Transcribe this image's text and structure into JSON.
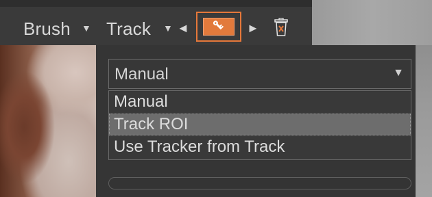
{
  "toolbar": {
    "brush_label": "Brush",
    "track_label": "Track",
    "dropdown_arrow": "▼",
    "prev_arrow": "◄",
    "next_arrow": "►",
    "key_button_icon": "key-icon",
    "delete_icon": "trash-icon",
    "accent_color": "#e6783a"
  },
  "tracking_mode": {
    "selected_value": "Manual",
    "caret": "▼",
    "options": [
      {
        "label": "Manual",
        "highlighted": false
      },
      {
        "label": "Track ROI",
        "highlighted": true
      },
      {
        "label": "Use Tracker from Track",
        "highlighted": false
      }
    ]
  },
  "progress": {
    "value": 0
  }
}
